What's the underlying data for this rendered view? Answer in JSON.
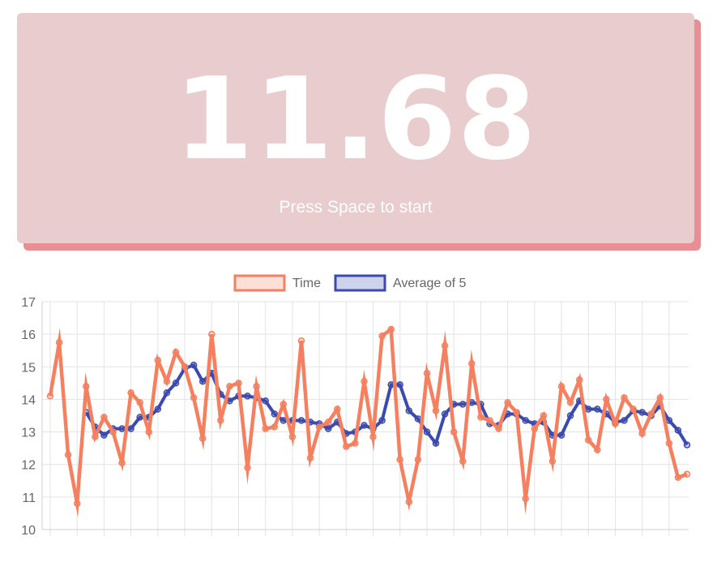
{
  "timer": {
    "value": "11.68",
    "hint": "Press Space to start"
  },
  "colors": {
    "card_bg": "#e9cccd",
    "card_shadow": "#e98e92",
    "time_line": "#f58060",
    "avg_line": "#3a4aaf",
    "grid": "#e3e3e3"
  },
  "chart_data": {
    "type": "line",
    "ylim": [
      10,
      17
    ],
    "yticks": [
      "10",
      "11",
      "12",
      "13",
      "14",
      "15",
      "16",
      "17"
    ],
    "legend_position": "top",
    "grid": true,
    "series": [
      {
        "name": "Time",
        "values": [
          14.1,
          15.75,
          12.3,
          10.8,
          14.4,
          12.85,
          13.45,
          13.0,
          12.05,
          14.2,
          13.9,
          13.0,
          15.2,
          14.55,
          15.45,
          15.0,
          14.05,
          12.8,
          16.0,
          13.35,
          14.4,
          14.5,
          11.9,
          14.4,
          13.1,
          13.15,
          13.85,
          12.85,
          15.8,
          12.2,
          13.15,
          13.3,
          13.7,
          12.55,
          12.65,
          14.55,
          12.85,
          15.95,
          16.15,
          12.15,
          10.85,
          12.15,
          14.8,
          13.65,
          15.65,
          13.0,
          12.1,
          15.1,
          13.45,
          13.35,
          13.1,
          13.9,
          13.6,
          10.95,
          13.1,
          13.5,
          12.1,
          14.4,
          13.9,
          14.6,
          12.75,
          12.45,
          14.0,
          13.25,
          14.05,
          13.7,
          12.95,
          13.55,
          14.05,
          12.65,
          11.6,
          11.7
        ],
        "color": "#f58060"
      },
      {
        "name": "Average of 5",
        "values": [
          null,
          null,
          null,
          null,
          13.6,
          13.15,
          12.9,
          13.1,
          13.1,
          13.1,
          13.45,
          13.45,
          13.7,
          14.2,
          14.5,
          14.95,
          15.05,
          14.55,
          14.8,
          14.15,
          13.95,
          14.1,
          14.1,
          14.05,
          13.95,
          13.55,
          13.35,
          13.35,
          13.35,
          13.3,
          13.25,
          13.1,
          13.3,
          12.95,
          13.0,
          13.2,
          13.1,
          13.35,
          14.45,
          14.45,
          13.65,
          13.4,
          13.0,
          12.65,
          13.55,
          13.85,
          13.85,
          13.9,
          13.85,
          13.25,
          13.2,
          13.55,
          13.55,
          13.35,
          13.25,
          13.3,
          12.9,
          12.9,
          13.5,
          13.95,
          13.7,
          13.7,
          13.55,
          13.3,
          13.35,
          13.65,
          13.6,
          13.5,
          13.8,
          13.35,
          13.05,
          12.6
        ],
        "color": "#3a4aaf"
      }
    ]
  }
}
